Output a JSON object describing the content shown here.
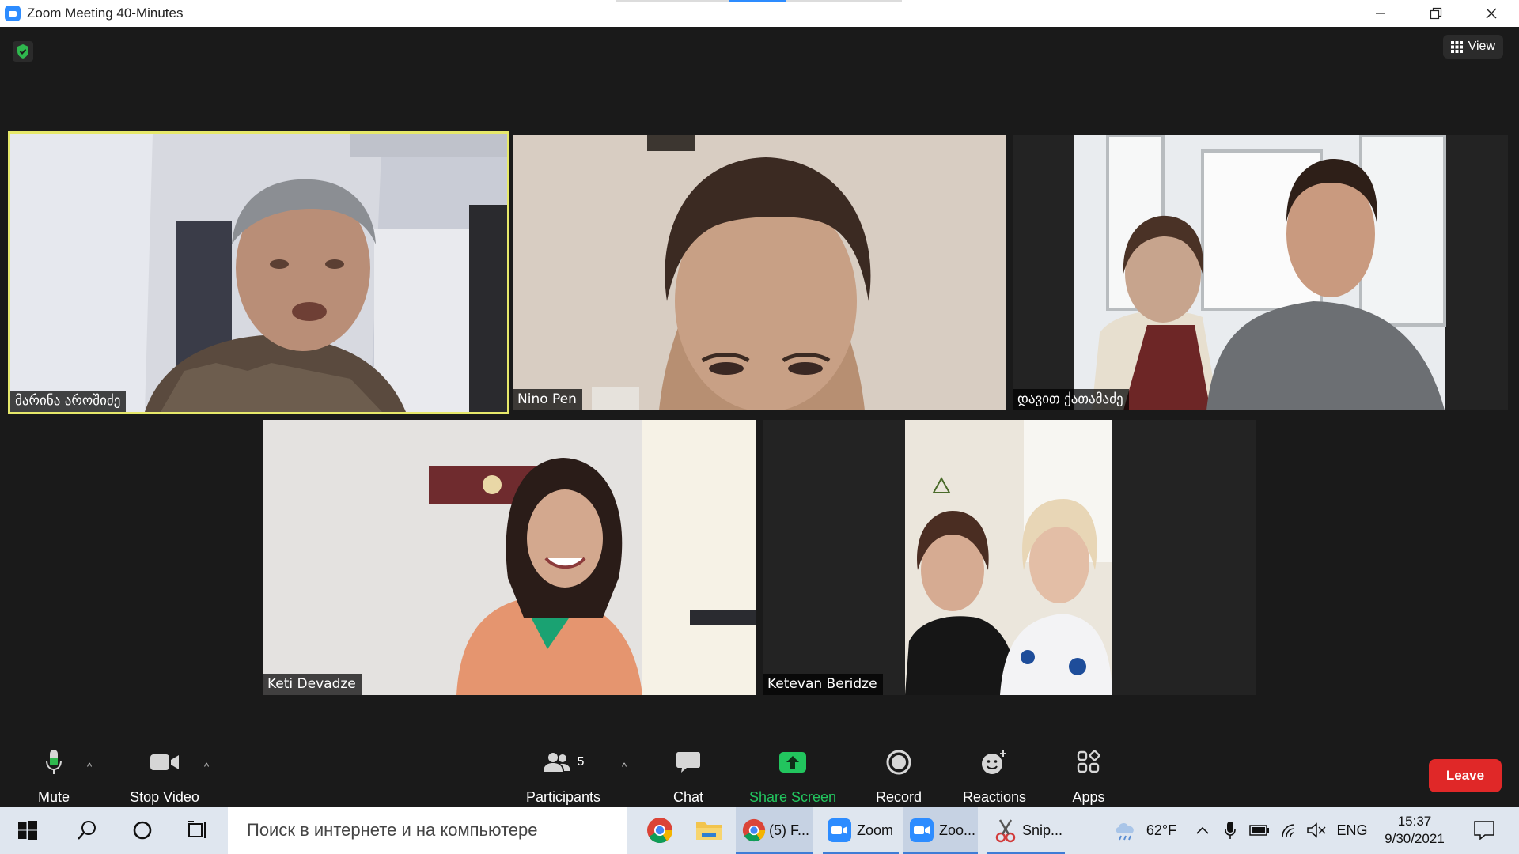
{
  "window": {
    "title": "Zoom Meeting 40-Minutes"
  },
  "header": {
    "view_label": "View"
  },
  "participants": [
    {
      "name": "მარინა აროშიძე",
      "active_speaker": true
    },
    {
      "name": "Nino Pen"
    },
    {
      "name": "დავით ქათამაძე"
    },
    {
      "name": "Keti Devadze"
    },
    {
      "name": "Ketevan Beridze"
    }
  ],
  "toolbar": {
    "mute_label": "Mute",
    "stop_video_label": "Stop Video",
    "participants_label": "Participants",
    "participants_count": "5",
    "chat_label": "Chat",
    "share_screen_label": "Share Screen",
    "record_label": "Record",
    "reactions_label": "Reactions",
    "apps_label": "Apps",
    "leave_label": "Leave"
  },
  "taskbar": {
    "search_placeholder": "Поиск в интернете и на компьютере",
    "apps": [
      {
        "label": "(5) F..."
      },
      {
        "label": "Zoom"
      },
      {
        "label": "Zoo..."
      },
      {
        "label": "Snip..."
      }
    ],
    "weather": "62°F",
    "language": "ENG",
    "time": "15:37",
    "date": "9/30/2021"
  },
  "colors": {
    "accent": "#2d8cff",
    "active_speaker_border": "#e6e86a",
    "share_green": "#22c55e",
    "leave_red": "#e02828",
    "shield_green": "#2fb84e"
  }
}
